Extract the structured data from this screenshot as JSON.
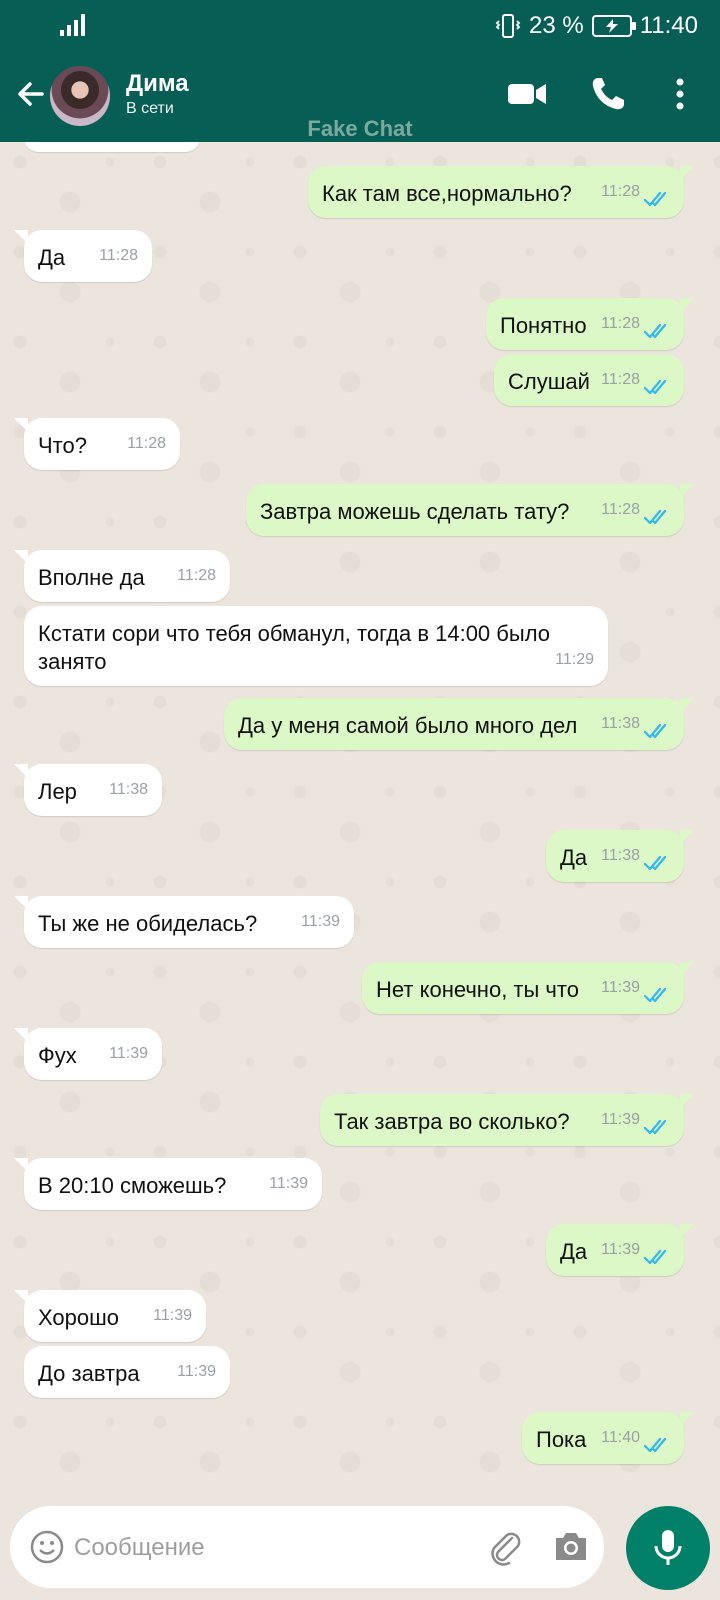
{
  "statusbar": {
    "battery": "23 %",
    "time": "11:40"
  },
  "header": {
    "name": "Дима",
    "status": "В сети"
  },
  "watermark": "Fake Chat",
  "messages": [
    {
      "dir": "out",
      "text": "Как там все,нормально?",
      "time": "11:28"
    },
    {
      "dir": "in",
      "text": "Да",
      "time": "11:28"
    },
    {
      "dir": "out",
      "text": "Понятно",
      "time": "11:28"
    },
    {
      "dir": "out",
      "text": "Слушай",
      "time": "11:28"
    },
    {
      "dir": "in",
      "text": "Что?",
      "time": "11:28"
    },
    {
      "dir": "out",
      "text": "Завтра можешь сделать тату?",
      "time": "11:28"
    },
    {
      "dir": "in",
      "text": "Вполне да",
      "time": "11:28"
    },
    {
      "dir": "in",
      "text": "Кстати сори что тебя обманул, тогда в 14:00 было занято",
      "time": "11:29"
    },
    {
      "dir": "out",
      "text": "Да у меня самой было много дел",
      "time": "11:38"
    },
    {
      "dir": "in",
      "text": "Лер",
      "time": "11:38"
    },
    {
      "dir": "out",
      "text": "Да",
      "time": "11:38"
    },
    {
      "dir": "in",
      "text": "Ты же не обиделась?",
      "time": "11:39"
    },
    {
      "dir": "out",
      "text": "Нет конечно, ты что",
      "time": "11:39"
    },
    {
      "dir": "in",
      "text": "Фух",
      "time": "11:39"
    },
    {
      "dir": "out",
      "text": "Так завтра во сколько?",
      "time": "11:39"
    },
    {
      "dir": "in",
      "text": "В 20:10 сможешь?",
      "time": "11:39"
    },
    {
      "dir": "out",
      "text": "Да",
      "time": "11:39"
    },
    {
      "dir": "in",
      "text": "Хорошо",
      "time": "11:39"
    },
    {
      "dir": "in",
      "text": "До завтра",
      "time": "11:39"
    },
    {
      "dir": "out",
      "text": "Пока",
      "time": "11:40"
    }
  ],
  "composer": {
    "placeholder": "Сообщение"
  },
  "colors": {
    "header": "#075E54",
    "outgoing": "#DCF8C6",
    "incoming": "#FFFFFF",
    "tick_read": "#34B7F1",
    "mic": "#008069"
  }
}
